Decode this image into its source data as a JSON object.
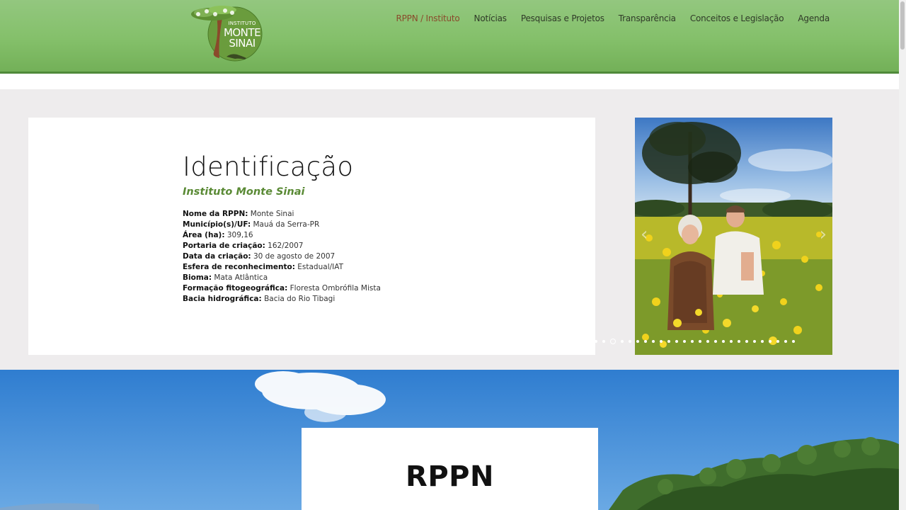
{
  "brand": {
    "logo_line1": "INSTITUTO",
    "logo_line2": "MONTE",
    "logo_line3": "SINAI"
  },
  "nav": {
    "items": [
      {
        "label": "RPPN / Instituto",
        "active": true
      },
      {
        "label": "Notícias"
      },
      {
        "label": "Pesquisas e Projetos"
      },
      {
        "label": "Transparência"
      },
      {
        "label": "Conceitos e Legislação"
      },
      {
        "label": "Agenda"
      }
    ]
  },
  "identificacao": {
    "title": "Identificação",
    "subtitle": "Instituto Monte Sinai",
    "facts": [
      {
        "label": "Nome da RPPN:",
        "value": "Monte Sinai"
      },
      {
        "label": "Município(s)/UF:",
        "value": "Mauá da Serra-PR"
      },
      {
        "label": "Área (ha):",
        "value": "309,16"
      },
      {
        "label": "Portaria de criação:",
        "value": "162/2007"
      },
      {
        "label": "Data da criação:",
        "value": "30 de agosto de 2007"
      },
      {
        "label": "Esfera de reconhecimento:",
        "value": "Estadual/IAT"
      },
      {
        "label": "Bioma:",
        "value": "Mata Atlântica"
      },
      {
        "label": "Formação fitogeográfica:",
        "value": "Floresta Ombrófila Mista"
      },
      {
        "label": "Bacia hidrográfica:",
        "value": "Bacia do Rio Tibagi"
      }
    ]
  },
  "slider": {
    "prev_icon": "chevron-left-icon",
    "next_icon": "chevron-right-icon",
    "prev_glyph": "‹",
    "next_glyph": "›",
    "dot_count": 26,
    "active_dot": 2
  },
  "hero": {
    "title": "RPPN"
  },
  "colors": {
    "header_green": "#84c06a",
    "nav_active": "#8a4a2b",
    "subtitle_green": "#5a8a35",
    "section_bg": "#eeeced"
  }
}
